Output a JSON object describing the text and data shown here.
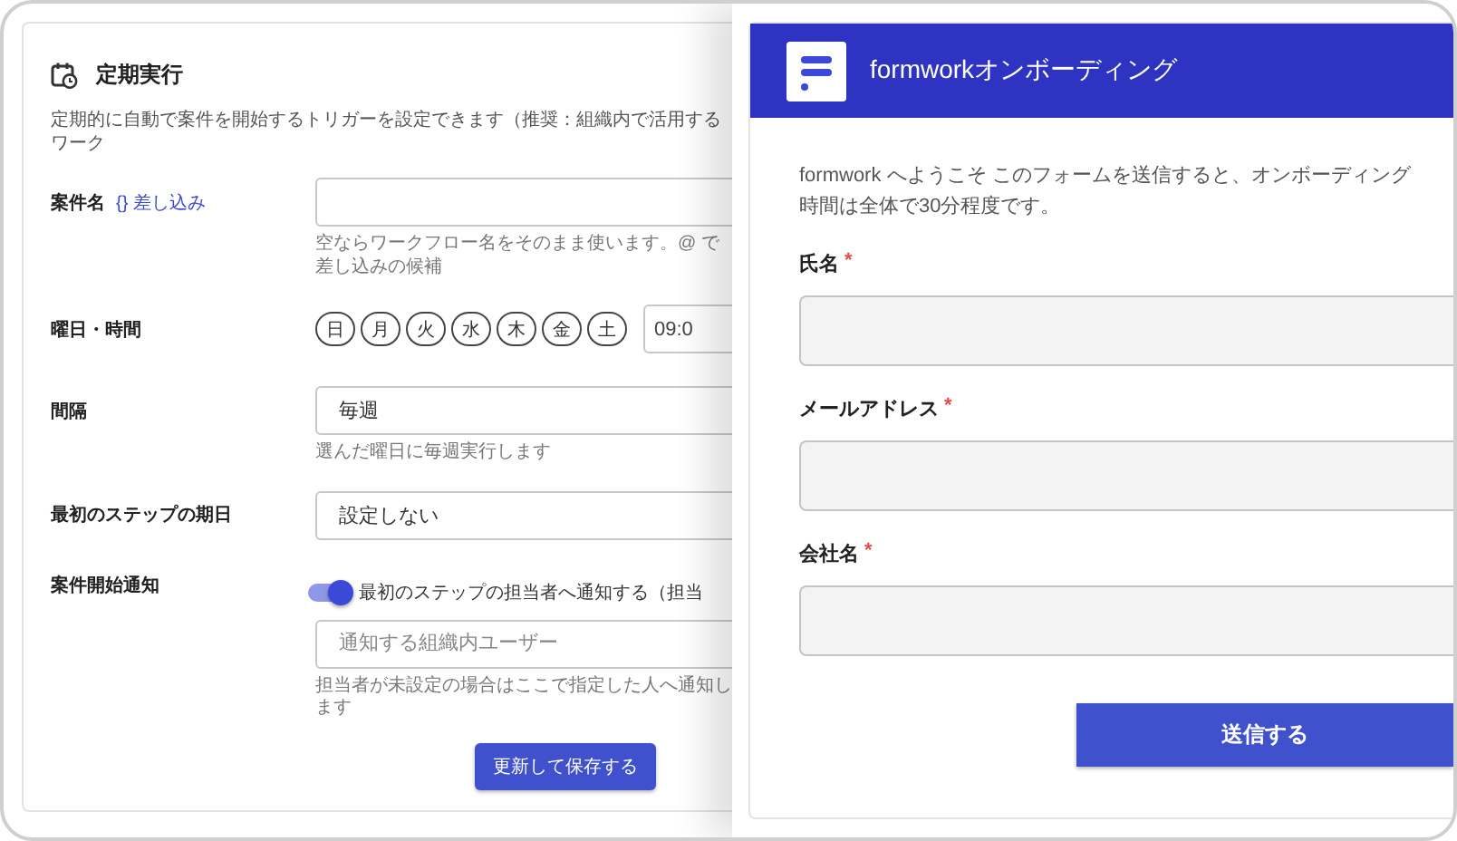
{
  "schedule": {
    "title": "定期実行",
    "description": "定期的に自動で案件を開始するトリガーを設定できます（推奨：組織内で活用するワーク",
    "case_name": {
      "label": "案件名",
      "insert_icon": "{}",
      "insert_label": "差し込み",
      "hint": "空ならワークフロー名をそのまま使います。@ で差し込みの候補"
    },
    "weekday_time": {
      "label": "曜日・時間",
      "days": [
        {
          "label": "日",
          "selected": false
        },
        {
          "label": "月",
          "selected": false
        },
        {
          "label": "火",
          "selected": false
        },
        {
          "label": "水",
          "selected": false
        },
        {
          "label": "木",
          "selected": false
        },
        {
          "label": "金",
          "selected": false
        },
        {
          "label": "土",
          "selected": false
        }
      ],
      "time_value": "09:0"
    },
    "interval": {
      "label": "間隔",
      "value": "毎週",
      "hint": "選んだ曜日に毎週実行します"
    },
    "first_step_due": {
      "label": "最初のステップの期日",
      "value": "設定しない"
    },
    "start_notice": {
      "label": "案件開始通知",
      "toggle_on": true,
      "toggle_label": "最初のステップの担当者へ通知する（担当",
      "user_placeholder": "通知する組織内ユーザー",
      "hint": "担当者が未設定の場合はここで指定した人へ通知します"
    },
    "save_button": "更新して保存する"
  },
  "form": {
    "title": "formworkオンボーディング",
    "intro_lines": [
      "formwork へようこそ このフォームを送信すると、オンボーディング",
      "時間は全体で30分程度です。"
    ],
    "fields": [
      {
        "label": "氏名",
        "required_mark": "*"
      },
      {
        "label": "メールアドレス",
        "required_mark": "*"
      },
      {
        "label": "会社名",
        "required_mark": "*"
      }
    ],
    "submit": "送信する"
  }
}
